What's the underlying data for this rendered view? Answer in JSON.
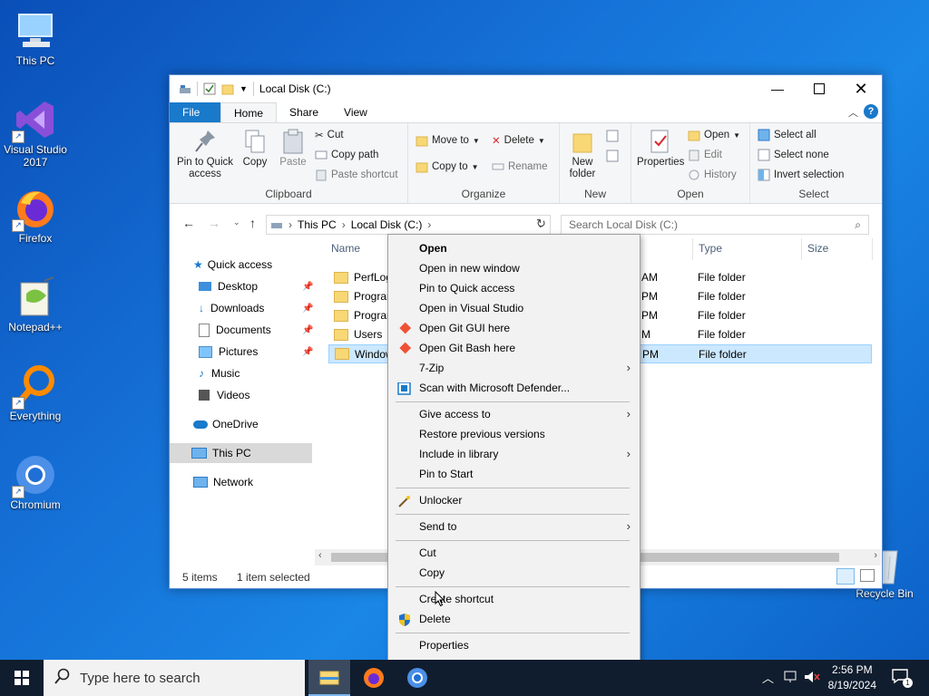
{
  "desktop": {
    "icons": [
      {
        "label": "This PC"
      },
      {
        "label": "Visual Studio 2017"
      },
      {
        "label": "Firefox"
      },
      {
        "label": "Notepad++"
      },
      {
        "label": "Everything"
      },
      {
        "label": "Chromium"
      },
      {
        "label": "Recycle Bin"
      }
    ]
  },
  "window": {
    "title": "Local Disk (C:)",
    "tabs": [
      "File",
      "Home",
      "Share",
      "View"
    ],
    "ribbon": {
      "clipboard": {
        "group": "Clipboard",
        "pin": "Pin to Quick access",
        "copy": "Copy",
        "paste": "Paste",
        "cut": "Cut",
        "copy_path": "Copy path",
        "paste_shortcut": "Paste shortcut"
      },
      "organize": {
        "group": "Organize",
        "move_to": "Move to",
        "copy_to": "Copy to",
        "delete": "Delete",
        "rename": "Rename"
      },
      "new": {
        "group": "New",
        "new_folder": "New folder"
      },
      "open": {
        "group": "Open",
        "properties": "Properties",
        "open": "Open",
        "edit": "Edit",
        "history": "History"
      },
      "select": {
        "group": "Select",
        "select_all": "Select all",
        "select_none": "Select none",
        "invert": "Invert selection"
      }
    },
    "address": {
      "crumbs": [
        "This PC",
        "Local Disk (C:)"
      ],
      "search_placeholder": "Search Local Disk (C:)"
    },
    "nav": [
      {
        "label": "Quick access"
      },
      {
        "label": "Desktop"
      },
      {
        "label": "Downloads"
      },
      {
        "label": "Documents"
      },
      {
        "label": "Pictures"
      },
      {
        "label": "Music"
      },
      {
        "label": "Videos"
      },
      {
        "label": "OneDrive"
      },
      {
        "label": "This PC"
      },
      {
        "label": "Network"
      }
    ],
    "columns": {
      "name": "Name",
      "type": "Type",
      "size": "Size"
    },
    "rows": [
      {
        "name": "PerfLog",
        "time_suffix": "AM",
        "type": "File folder"
      },
      {
        "name": "Program",
        "time_suffix": "PM",
        "type": "File folder"
      },
      {
        "name": "Program",
        "time_suffix": "PM",
        "type": "File folder"
      },
      {
        "name": "Users",
        "time_suffix": "M",
        "type": "File folder"
      },
      {
        "name": "Window",
        "time_suffix": "PM",
        "type": "File folder"
      }
    ],
    "status": {
      "items": "5 items",
      "selected": "1 item selected"
    }
  },
  "context_menu": {
    "items": [
      "Open",
      "Open in new window",
      "Pin to Quick access",
      "Open in Visual Studio",
      "Open Git GUI here",
      "Open Git Bash here",
      "7-Zip",
      "Scan with Microsoft Defender...",
      "Give access to",
      "Restore previous versions",
      "Include in library",
      "Pin to Start",
      "Unlocker",
      "Send to",
      "Cut",
      "Copy",
      "Create shortcut",
      "Delete",
      "Properties"
    ]
  },
  "taskbar": {
    "search_placeholder": "Type here to search",
    "time": "2:56 PM",
    "date": "8/19/2024",
    "notif_count": "1"
  }
}
